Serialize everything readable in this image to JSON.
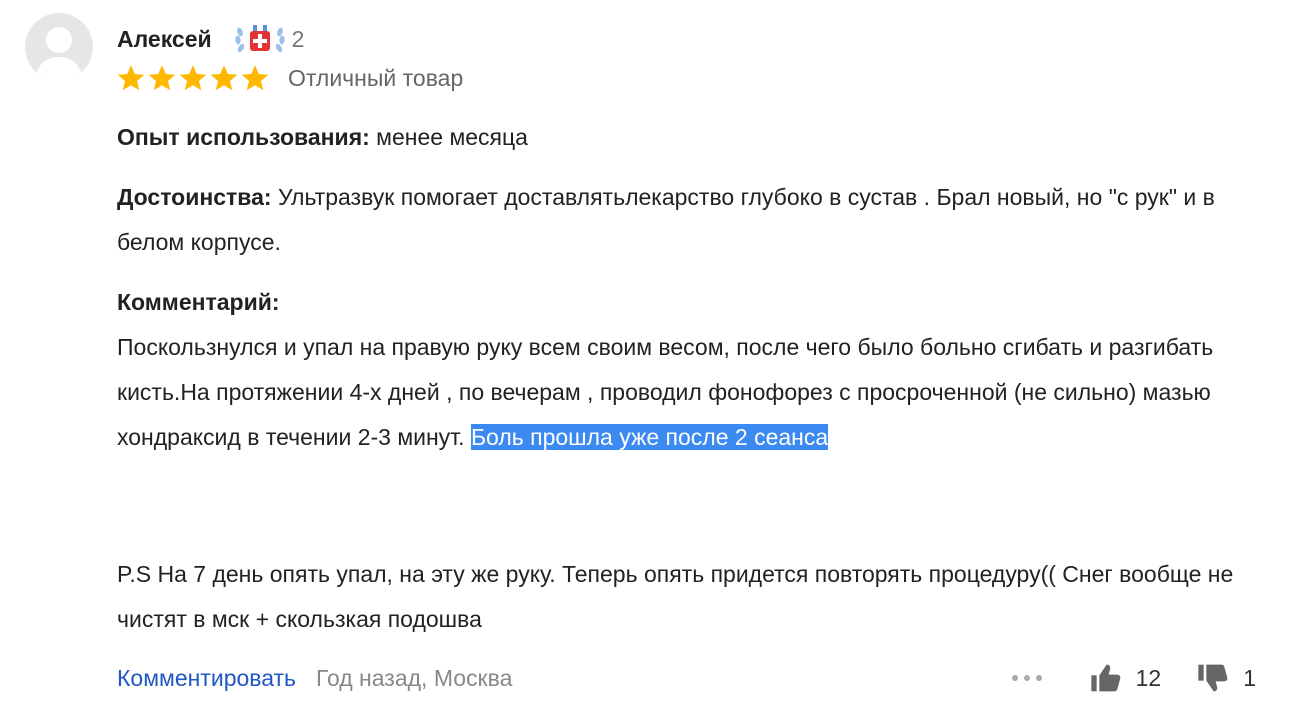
{
  "author": {
    "name": "Алексей",
    "reviews_count": "2",
    "avatar_icon": "user-silhouette-icon",
    "badge_icon": "laurel-medal-icon"
  },
  "rating": {
    "stars": 5,
    "max_stars": 5,
    "text": "Отличный товар",
    "star_color": "#ffb800"
  },
  "experience": {
    "label": "Опыт использования:",
    "value": "менее месяца"
  },
  "pros": {
    "label": "Достоинства:",
    "value": "Ультразвук помогает доставлятьлекарство глубоко в сустав . Брал новый, но \"с рук\" и в белом корпусе."
  },
  "comment": {
    "label": "Комментарий:",
    "text_plain": "Поскользнулся и упал на правую руку всем своим весом, после чего было больно сгибать и разгибать кисть.На протяжении 4-х дней , по вечерам , проводил фонофорез с просроченной (не сильно) мазью хондраксид в течении 2-3 минут. ",
    "text_selected": "Боль прошла уже после 2 сеанса",
    "ps": "P.S На 7 день опять упал, на эту же руку. Теперь опять придется повторять процедуру(( Снег вообще не чистят в мск + скользкая подошва"
  },
  "footer": {
    "comment_link": "Комментировать",
    "meta": "Год назад, Москва",
    "likes": "12",
    "dislikes": "1",
    "link_color": "#1f57c6",
    "selection_color": "#3b8af1"
  }
}
